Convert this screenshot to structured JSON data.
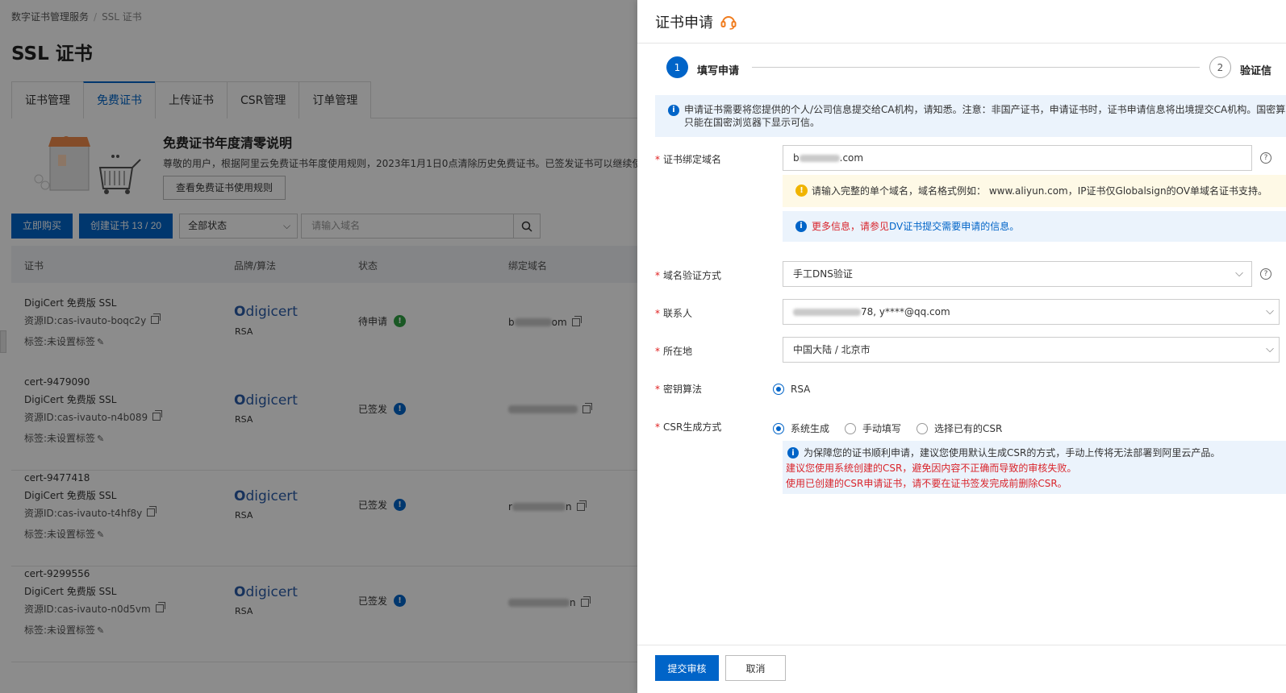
{
  "breadcrumb": {
    "root": "数字证书管理服务",
    "current": "SSL 证书"
  },
  "page_title": "SSL 证书",
  "tabs": [
    "证书管理",
    "免费证书",
    "上传证书",
    "CSR管理",
    "订单管理"
  ],
  "notice": {
    "title": "免费证书年度清零说明",
    "desc": "尊敬的用户，根据阿里云免费证书年度使用规则，2023年1月1日0点清除历史免费证书。已签发证书可以继续使用",
    "button": "查看免费证书使用规则"
  },
  "toolbar": {
    "buy": "立即购买",
    "create": "创建证书 13 / 20",
    "status_select": "全部状态",
    "search_placeholder": "请输入域名"
  },
  "table": {
    "headers": {
      "cert": "证书",
      "brand": "品牌/算法",
      "status": "状态",
      "domain": "绑定域名"
    },
    "rows": [
      {
        "id": "",
        "name": "DigiCert 免费版 SSL",
        "resource": "资源ID:cas-ivauto-boqc2y",
        "tag": "标签:未设置标签",
        "brand": "digicert",
        "algo": "RSA",
        "status": "待申请",
        "domain_prefix": "b",
        "domain_suffix": "om"
      },
      {
        "id": "cert-9479090",
        "name": "DigiCert 免费版 SSL",
        "resource": "资源ID:cas-ivauto-n4b089",
        "tag": "标签:未设置标签",
        "brand": "digicert",
        "algo": "RSA",
        "status": "已签发",
        "domain_prefix": "",
        "domain_suffix": ""
      },
      {
        "id": "cert-9477418",
        "name": "DigiCert 免费版 SSL",
        "resource": "资源ID:cas-ivauto-t4hf8y",
        "tag": "标签:未设置标签",
        "brand": "digicert",
        "algo": "RSA",
        "status": "已签发",
        "domain_prefix": "r",
        "domain_suffix": "n"
      },
      {
        "id": "cert-9299556",
        "name": "DigiCert 免费版 SSL",
        "resource": "资源ID:cas-ivauto-n0d5vm",
        "tag": "标签:未设置标签",
        "brand": "digicert",
        "algo": "RSA",
        "status": "已签发",
        "domain_prefix": "",
        "domain_suffix": "n"
      }
    ]
  },
  "drawer": {
    "title": "证书申请",
    "steps": [
      {
        "num": "1",
        "label": "填写申请"
      },
      {
        "num": "2",
        "label": "验证信"
      }
    ],
    "info_text_1": "申请证书需要将您提供的个人/公司信息提交给CA机构，请知悉。注意：非国产证书，申请证书时，证书申请信息将出境提交CA机构。国密算",
    "info_text_2": "只能在国密浏览器下显示可信。",
    "fields": {
      "domain": {
        "label": "证书绑定域名",
        "value_prefix": "b",
        "value_suffix": ".com"
      },
      "domain_warn": "请输入完整的单个域名，域名格式例如： www.aliyun.com，IP证书仅Globalsign的OV单域名证书支持。",
      "more_info_red": "更多信息，请参见",
      "more_info_link": "DV证书提交需要申请的信息。",
      "verify": {
        "label": "域名验证方式",
        "value": "手工DNS验证"
      },
      "contact": {
        "label": "联系人",
        "value": "78, y****@qq.com"
      },
      "location": {
        "label": "所在地",
        "value": "中国大陆 / 北京市"
      },
      "key_algo": {
        "label": "密钥算法",
        "option": "RSA"
      },
      "csr": {
        "label": "CSR生成方式",
        "options": [
          "系统生成",
          "手动填写",
          "选择已有的CSR"
        ],
        "tip": "为保障您的证书顺利申请，建议您使用默认生成CSR的方式，手动上传将无法部署到阿里云产品。",
        "warn_1": "建议您使用系统创建的CSR，避免因内容不正确而导致的审核失败。",
        "warn_2": "使用已创建的CSR申请证书，请不要在证书签发完成前删除CSR。"
      }
    },
    "submit": "提交审核",
    "cancel": "取消"
  },
  "colors": {
    "primary": "#0064c8",
    "danger": "#d9242b",
    "warning": "#f0b400",
    "success": "#2ea043"
  }
}
